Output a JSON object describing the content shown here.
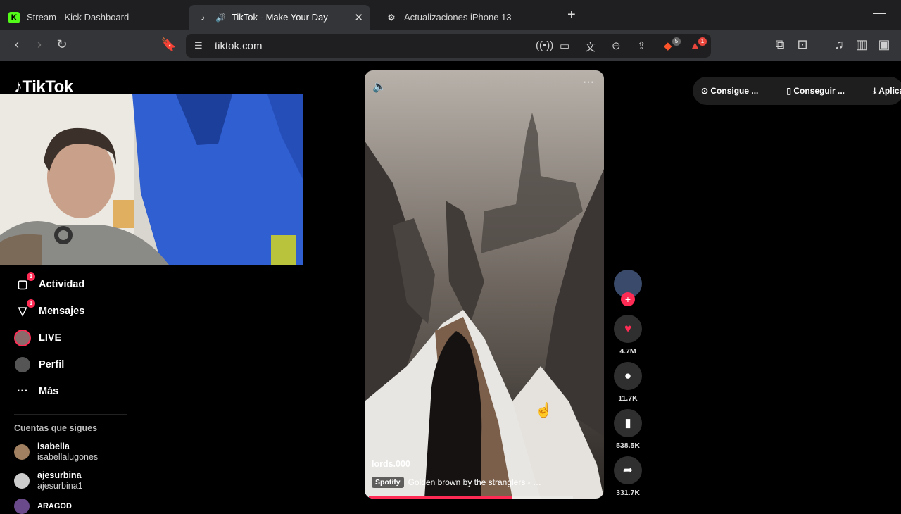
{
  "browser": {
    "tabs": [
      {
        "title": "Stream - Kick Dashboard",
        "favicon": "kick-icon"
      },
      {
        "title": "TikTok - Make Your Day",
        "favicon": "tiktok-icon"
      },
      {
        "title": "Actualizaciones iPhone 13",
        "favicon": "chatgpt-icon"
      }
    ],
    "url": "tiktok.com",
    "brave_badge": "5",
    "alert_badge": "1"
  },
  "tiktok": {
    "logo_text": "TikTok",
    "nav": [
      {
        "label": "Actividad",
        "icon": "activity-icon",
        "badge": "1"
      },
      {
        "label": "Mensajes",
        "icon": "messages-icon",
        "badge": "1"
      },
      {
        "label": "LIVE",
        "icon": "live-icon"
      },
      {
        "label": "Perfil",
        "icon": "profile-icon"
      },
      {
        "label": "Más",
        "icon": "more-icon"
      }
    ],
    "following_title": "Cuentas que sigues",
    "following": [
      {
        "name": "isabella",
        "username": "isabellalugones"
      },
      {
        "name": "ajesurbina",
        "username": "ajesurbina1"
      },
      {
        "name": "ARAGOD",
        "username": ""
      }
    ],
    "video": {
      "author": "lords.000",
      "music_tag": "Spotify",
      "music": "Golden brown by the stranglers - …",
      "progress": 0.7
    },
    "actions": {
      "likes": "4.7M",
      "comments": "11.7K",
      "saves": "538.5K",
      "shares": "331.7K"
    },
    "top_links": [
      "Consigue ...",
      "Conseguir ...",
      "Aplicación"
    ]
  },
  "colors": {
    "accent": "#fe2c55",
    "chrome_dark": "#1f1f21",
    "chrome": "#343538"
  }
}
